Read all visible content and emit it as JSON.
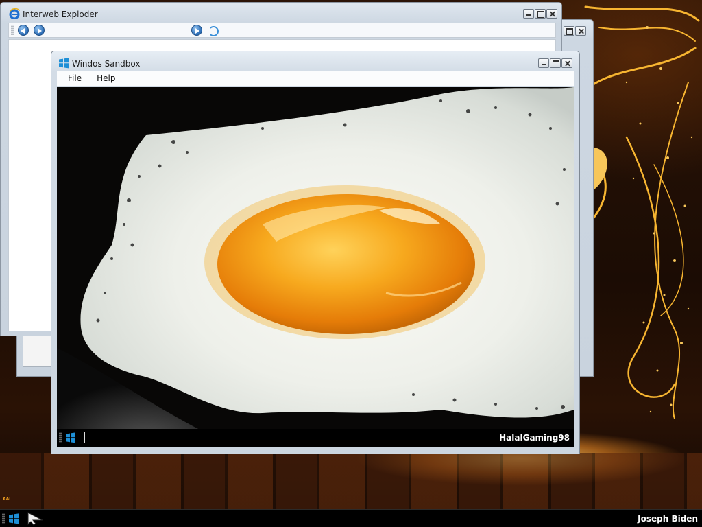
{
  "desktop": {
    "wallpaper": "dark-wood-golden-swirls",
    "watermark": "AAL"
  },
  "browser": {
    "title": "Interweb Exploder",
    "icon": "ie-logo-icon",
    "toolbar": {
      "back_icon": "back-arrow-icon",
      "forward_icon": "forward-arrow-icon",
      "go_icon": "go-arrow-icon",
      "refresh_icon": "refresh-icon",
      "address_value": ""
    },
    "controls": [
      "minimize",
      "maximize",
      "close"
    ]
  },
  "back_window": {
    "controls": [
      "maximize",
      "close"
    ]
  },
  "sandbox": {
    "title": "Windos Sandbox",
    "icon": "windows-logo-icon",
    "menu": [
      "File",
      "Help"
    ],
    "screen_image": "fried-egg-photo",
    "inner_taskbar": {
      "start_icon": "windows-logo-icon",
      "user": "HalalGaming98"
    },
    "controls": [
      "minimize",
      "maximize",
      "close"
    ]
  },
  "taskbar": {
    "start_icon": "windows-logo-icon",
    "user": "Joseph Biden"
  },
  "colors": {
    "accent_blue": "#1e8fd6",
    "taskbar": "#000000",
    "window_chrome": "#cdd7e2",
    "yolk": "#f39a12",
    "wallpaper_gold": "#f7b531"
  }
}
